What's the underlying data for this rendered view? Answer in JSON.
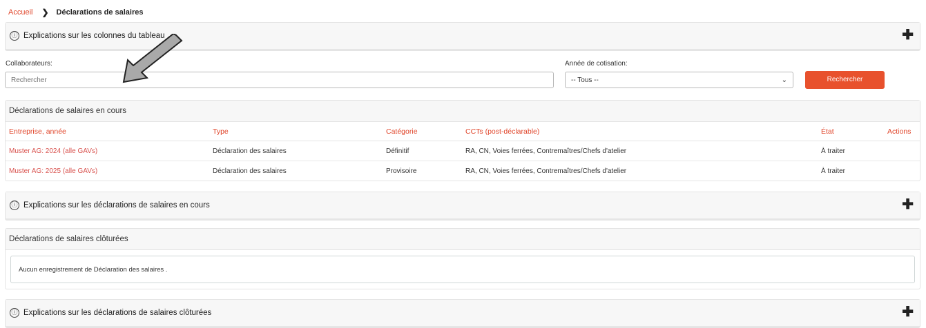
{
  "breadcrumb": {
    "home": "Accueil",
    "separator": "❯",
    "current": "Déclarations de salaires"
  },
  "info_icon": "ⓘ",
  "plus_icon": "✚",
  "explain_columns": {
    "title": "Explications sur les colonnes du tableau"
  },
  "filters": {
    "collaborateurs_label": "Collaborateurs:",
    "collaborateurs_value": "Rechercher",
    "annee_label": "Année de cotisation:",
    "annee_value": "-- Tous --",
    "search_button": "Rechercher"
  },
  "current_declarations": {
    "title": "Déclarations de salaires en cours",
    "columns": [
      "Entreprise, année",
      "Type",
      "Catégorie",
      "CCTs (post-déclarable)",
      "État",
      "Actions"
    ],
    "rows": [
      [
        "Muster AG: 2024 (alle GAVs)",
        "Déclaration des salaires",
        "Définitif",
        "RA, CN, Voies ferrées, Contremaîtres/Chefs d'atelier",
        "À traiter",
        ""
      ],
      [
        "Muster AG: 2025 (alle GAVs)",
        "Déclaration des salaires",
        "Provisoire",
        "RA, CN, Voies ferrées, Contremaîtres/Chefs d'atelier",
        "À traiter",
        ""
      ]
    ]
  },
  "explain_current": {
    "title": "Explications sur les déclarations de salaires en cours"
  },
  "closed_declarations": {
    "title": "Déclarations de salaires clôturées",
    "empty_message": "Aucun enregistrement de Déclaration des salaires ."
  },
  "explain_closed": {
    "title": "Explications sur les déclarations de salaires clôturées"
  },
  "colors": {
    "accent": "#e8512d",
    "link": "#d9534f",
    "panel_bg": "#f7f7f7"
  }
}
